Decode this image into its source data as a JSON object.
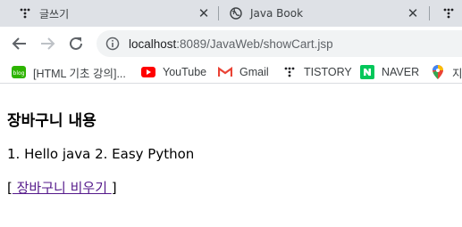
{
  "browser": {
    "tabs": [
      {
        "title": "글쓰기",
        "icon": "tistory-icon"
      },
      {
        "title": "Java Book",
        "icon": "globe-icon"
      }
    ],
    "address": {
      "host": "localhost",
      "rest": ":8089/JavaWeb/showCart.jsp"
    },
    "bookmarks": [
      {
        "label": "[HTML 기초 강의]...",
        "icon": "blog-icon"
      },
      {
        "label": "YouTube",
        "icon": "youtube-icon"
      },
      {
        "label": "Gmail",
        "icon": "gmail-icon"
      },
      {
        "label": "TISTORY",
        "icon": "tistory-icon"
      },
      {
        "label": "NAVER",
        "icon": "naver-icon"
      },
      {
        "label": "지",
        "icon": "maps-pin-icon"
      }
    ]
  },
  "page": {
    "heading": "장바구니 내용",
    "items_text": "1. Hello java 2. Easy Python",
    "clear_open": "[",
    "clear_link": " 장바구니 비우기 ",
    "clear_close": "]"
  },
  "colors": {
    "visited_link": "#551a8b",
    "tabstrip": "#dee1e6",
    "omnibox": "#f1f3f4"
  }
}
